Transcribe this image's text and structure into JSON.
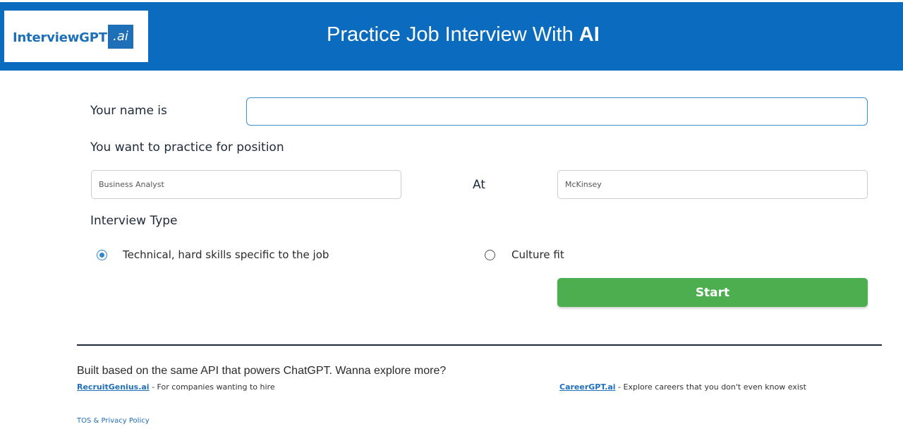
{
  "header": {
    "logo_text": "InterviewGPT",
    "logo_badge": ".ai",
    "title_prefix": "Practice Job Interview With ",
    "title_strong": "AI",
    "background_color": "#0b6bbf"
  },
  "form": {
    "name_label": "Your name is",
    "name_value": "",
    "position_label": "You want to practice for position",
    "position_value": "Business Analyst",
    "at_label": "At",
    "company_value": "McKinsey",
    "interview_type_label": "Interview Type",
    "interview_types": [
      {
        "label": "Technical, hard skills specific to the job",
        "checked": true
      },
      {
        "label": "Culture fit",
        "checked": false
      }
    ],
    "start_label": "Start",
    "start_color": "#4cae4f"
  },
  "footer": {
    "intro": "Built based on the same API that powers ChatGPT. Wanna explore more?",
    "links": [
      {
        "name": "RecruitGenius.ai",
        "description": " - For companies wanting to hire"
      },
      {
        "name": "CareerGPT.ai",
        "description": " - Explore careers that you don't even know exist"
      }
    ],
    "tos": "TOS & Privacy Policy"
  }
}
